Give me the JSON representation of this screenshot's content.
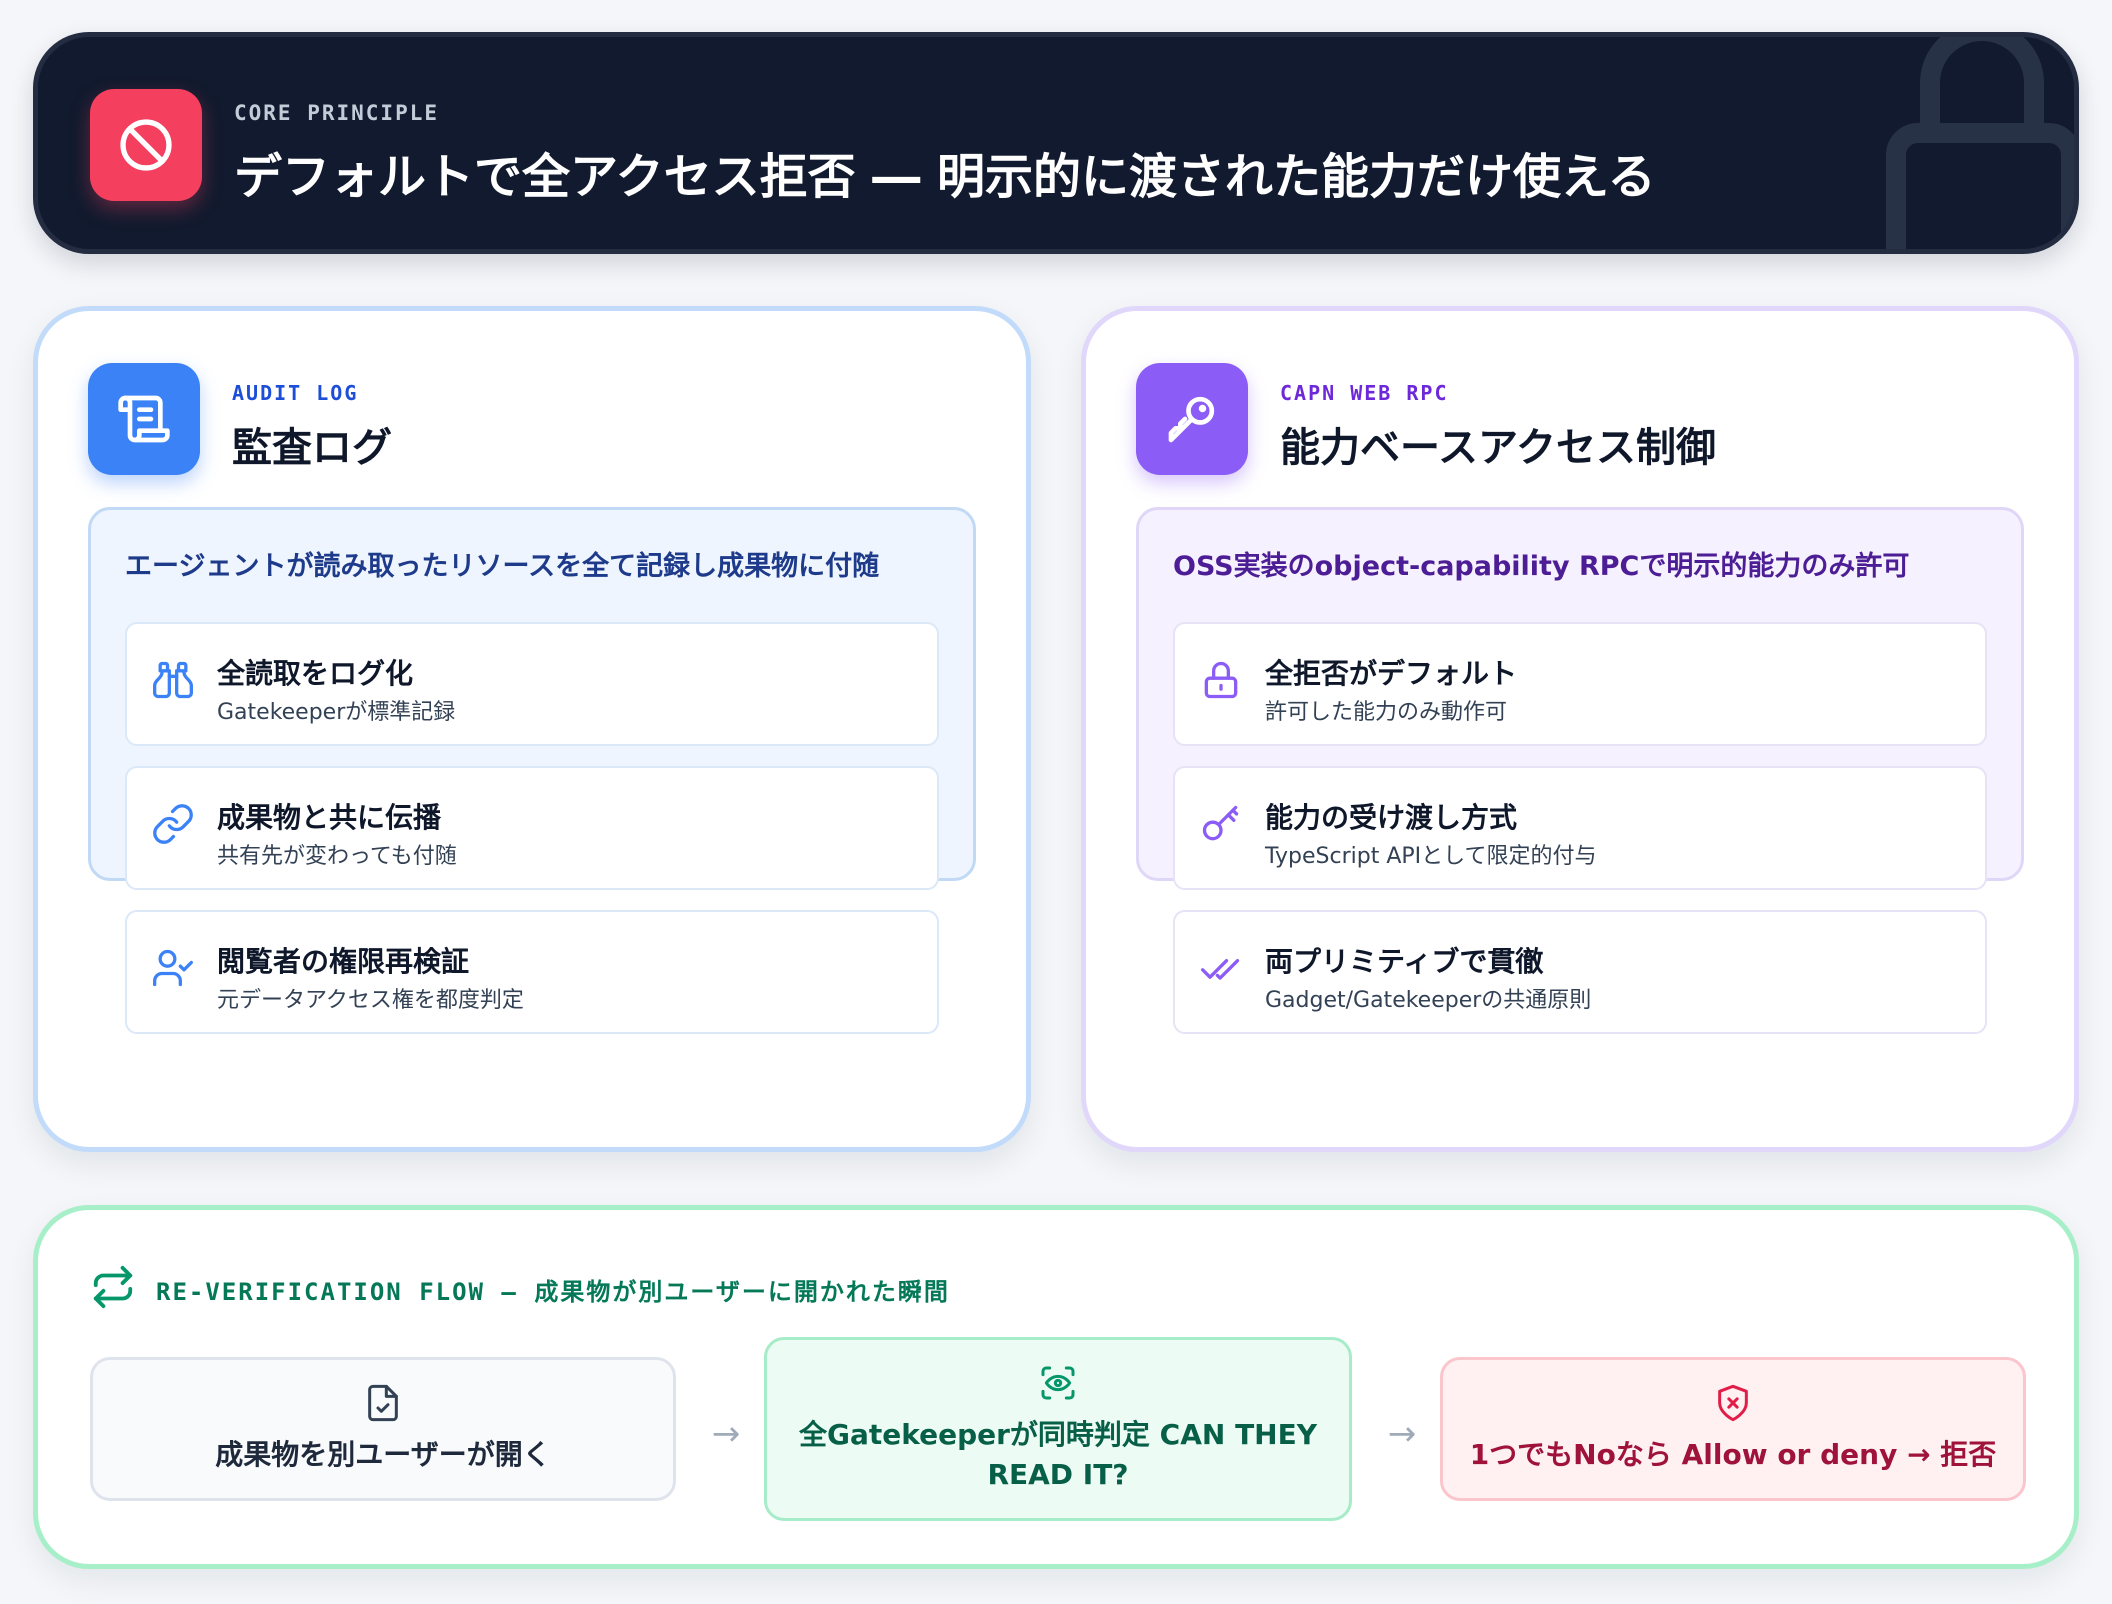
{
  "banner": {
    "kicker": "CORE PRINCIPLE",
    "title": "デフォルトで全アクセス拒否 ― 明示的に渡された能力だけ使える",
    "icon": "ban-icon",
    "watermark_icon": "lock-icon",
    "accent": "#f43f5e"
  },
  "audit": {
    "kicker": "AUDIT LOG",
    "title": "監査ログ",
    "icon": "scroll-icon",
    "accent": "#3b82f6",
    "headline": "エージェントが読み取ったリソースを全て記録し成果物に付随",
    "items": [
      {
        "title": "全読取をログ化",
        "sub": "Gatekeeperが標準記録",
        "icon": "binoculars-icon"
      },
      {
        "title": "成果物と共に伝播",
        "sub": "共有先が変わっても付随",
        "icon": "link-icon"
      },
      {
        "title": "閲覧者の権限再検証",
        "sub": "元データアクセス権を都度判定",
        "icon": "user-check-icon"
      }
    ]
  },
  "capn": {
    "kicker": "CAPN WEB RPC",
    "title": "能力ベースアクセス制御",
    "icon": "key-icon",
    "accent": "#8b5cf6",
    "headline": "OSS実装のobject-capability RPCで明示的能力のみ許可",
    "items": [
      {
        "title": "全拒否がデフォルト",
        "sub": "許可した能力のみ動作可",
        "icon": "lock-icon"
      },
      {
        "title": "能力の受け渡し方式",
        "sub": "TypeScript APIとして限定的付与",
        "icon": "key-icon"
      },
      {
        "title": "両プリミティブで貫徹",
        "sub": "Gadget/Gatekeeperの共通原則",
        "icon": "check-double-icon"
      }
    ]
  },
  "flow": {
    "heading": "RE-VERIFICATION FLOW – 成果物が別ユーザーに開かれた瞬間",
    "icon": "repeat-icon",
    "accent": "#047857",
    "steps": [
      {
        "label": "成果物を別ユーザーが開く",
        "icon": "file-check-icon"
      },
      {
        "label": "全Gatekeeperが同時判定 CAN THEY READ IT?",
        "icon": "scan-eye-icon"
      },
      {
        "label": "1つでもNoなら Allow or deny → 拒否",
        "icon": "shield-x-icon"
      }
    ],
    "arrow": "→"
  }
}
